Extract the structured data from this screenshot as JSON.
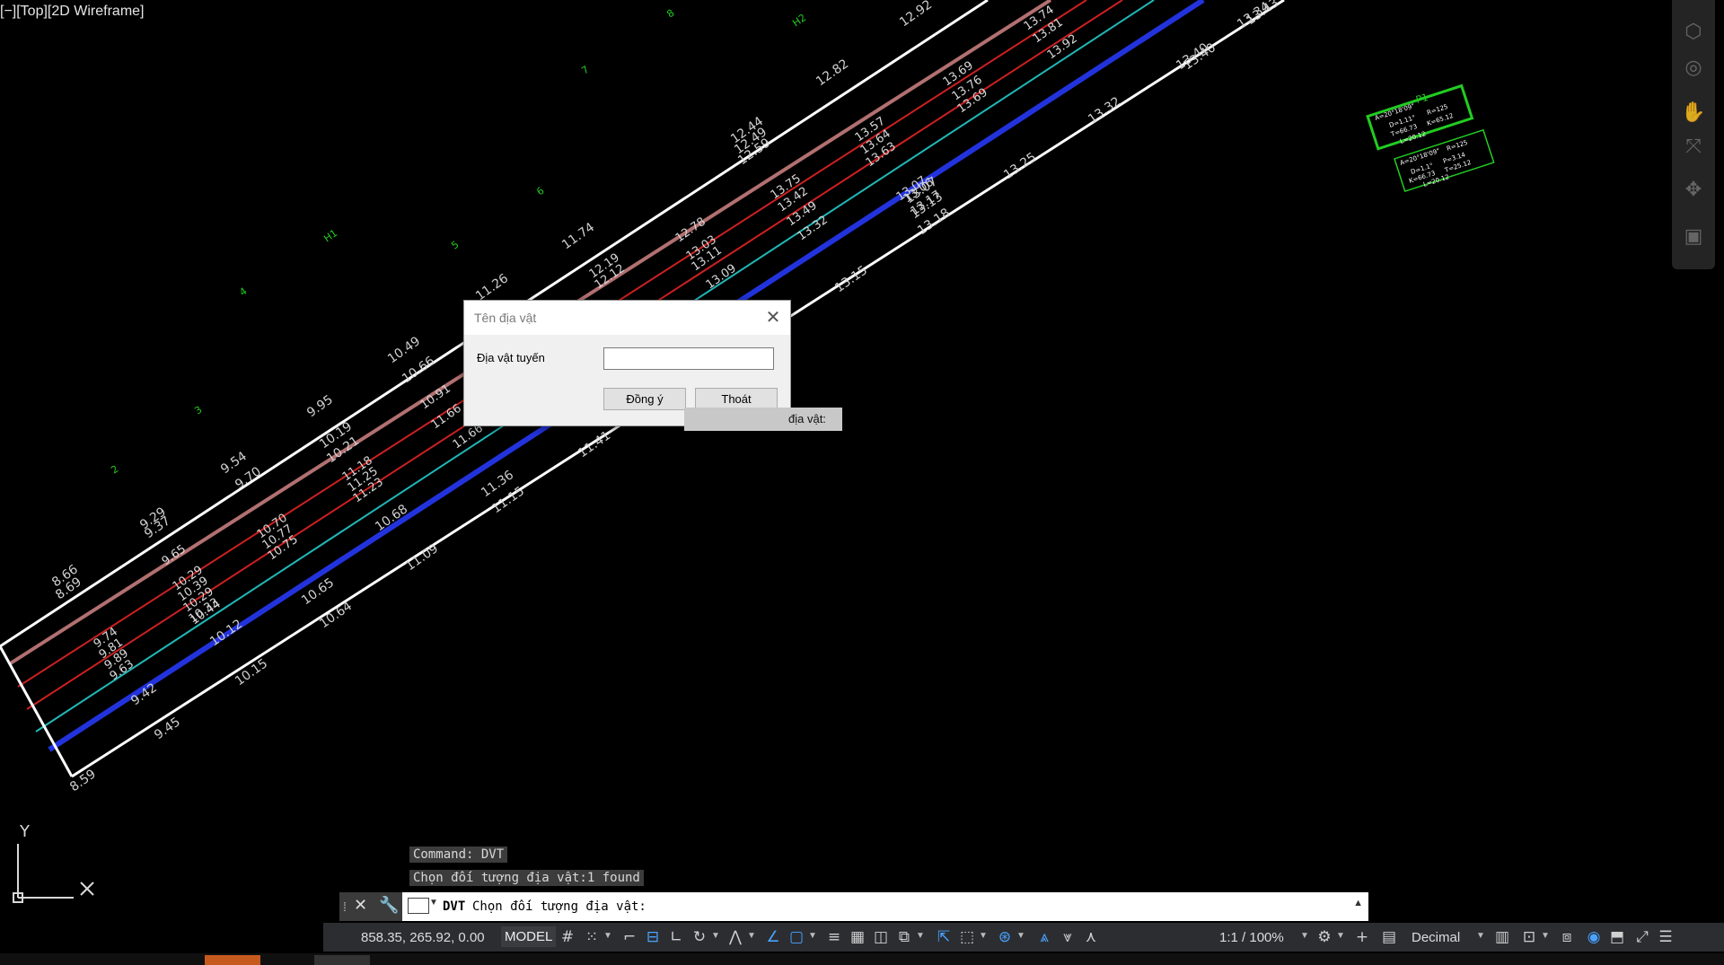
{
  "viewport": {
    "label": "[−][Top][2D Wireframe]"
  },
  "drawing_labels": {
    "station_numbers": [
      "2",
      "3",
      "4",
      "5",
      "6",
      "7",
      "8",
      "H1",
      "H2",
      "P1"
    ],
    "elevations_top": [
      "8.66",
      "8.69",
      "9.29",
      "9.37",
      "9.54",
      "9.70",
      "9.95",
      "10.19",
      "10.21",
      "10.49",
      "10.66",
      "11.26",
      "11.74",
      "12.44",
      "12.49",
      "12.59",
      "12.82",
      "12.92",
      "13.34",
      "13.40"
    ],
    "elevations_center": [
      "9.74",
      "9.81",
      "9.89",
      "9.63",
      "9.65",
      "10.29",
      "10.39",
      "10.29",
      "10.33",
      "10.44",
      "10.70",
      "10.77",
      "10.75",
      "11.18",
      "11.25",
      "11.23",
      "10.91",
      "11.66",
      "11.66",
      "12.19",
      "12.12",
      "12.78",
      "13.03",
      "13.11",
      "13.09",
      "13.75",
      "13.42",
      "13.49",
      "13.32",
      "13.57",
      "13.64",
      "13.63",
      "13.69",
      "13.76",
      "13.69",
      "13.74",
      "13.81",
      "13.92",
      "13.06",
      "13.07",
      "13.17"
    ],
    "elevations_bottom": [
      "8.59",
      "9.42",
      "9.45",
      "10.15",
      "10.12",
      "10.65",
      "10.64",
      "10.68",
      "11.09",
      "11.36",
      "11.15",
      "11.41",
      "13.07",
      "13.13",
      "13.18",
      "13.25",
      "13.32",
      "13.40",
      "13.43",
      "13.15"
    ],
    "curve_box_1": [
      "A=20°18'09\"",
      "D=1.11°",
      "R=125",
      "T=66.73",
      "K=65.12",
      "L=20.12"
    ],
    "curve_box_2": [
      "A=20°18'09\"",
      "R=125",
      "D=1.1°",
      "P=3.14",
      "K=66.73",
      "T=25.12",
      "L=20.12"
    ]
  },
  "dialog": {
    "title": "Tên địa vật",
    "field_label": "Địa vật tuyến",
    "field_value": "",
    "ok_label": "Đồng ý",
    "exit_label": "Thoát"
  },
  "tooltip_fragment": "địa vật:",
  "command_history": [
    "Command: DVT",
    "Chọn đối tượng địa vật:1 found"
  ],
  "command_line": {
    "command": "DVT",
    "prompt": "Chọn đối tượng địa vật:"
  },
  "status_bar": {
    "coordinates": "858.35, 265.92, 0.00",
    "space": "MODEL",
    "annotation_scale": "1:1 / 100%",
    "units": "Decimal"
  },
  "ucs": {
    "x_axis": "X",
    "y_axis": "Y"
  },
  "colors": {
    "background": "#000000",
    "boundary": "#ffffff",
    "centerline_brown": "#b27070",
    "offset_red": "#cc2020",
    "offset_cyan": "#20b8b8",
    "edge_blue": "#2233dd",
    "station_green": "#22cc22"
  }
}
